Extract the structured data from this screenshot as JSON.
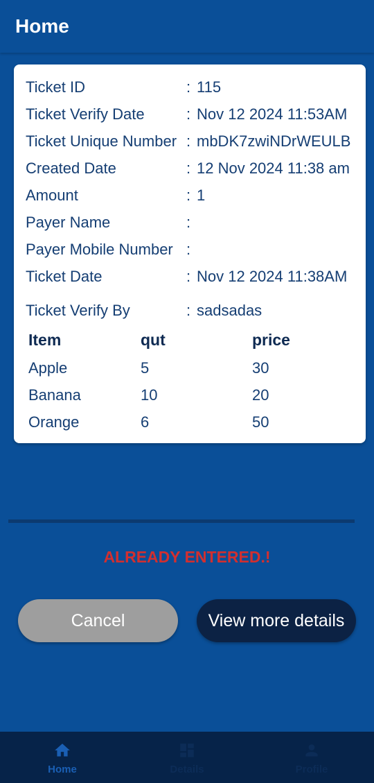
{
  "app_bar": {
    "title": "Home"
  },
  "ticket": {
    "fields": [
      {
        "label": "Ticket ID",
        "value": "115"
      },
      {
        "label": "Ticket Verify Date",
        "value": "Nov 12 2024 11:53AM"
      },
      {
        "label": "Ticket Unique Number",
        "value": "mbDK7zwiNDrWEULB"
      },
      {
        "label": "Created Date",
        "value": "12 Nov 2024 11:38 am"
      },
      {
        "label": "Amount",
        "value": "1"
      },
      {
        "label": "Payer Name",
        "value": ""
      },
      {
        "label": "Payer Mobile Number",
        "value": ""
      },
      {
        "label": "Ticket Date",
        "value": "Nov 12 2024 11:38AM"
      },
      {
        "label": "Ticket Verify By",
        "value": "sadsadas"
      }
    ],
    "separator": ":",
    "items_table": {
      "headers": [
        "Item",
        "qut",
        "price"
      ],
      "rows": [
        [
          "Apple",
          "5",
          "30"
        ],
        [
          "Banana",
          "10",
          "20"
        ],
        [
          "Orange",
          "6",
          "50"
        ]
      ]
    }
  },
  "status": {
    "text": "ALREADY ENTERED.!",
    "color": "#d22f2f"
  },
  "actions": {
    "cancel_label": "Cancel",
    "view_more_label": "View more details"
  },
  "bottom_nav": {
    "items": [
      {
        "label": "Home",
        "icon": "home-icon",
        "active": true
      },
      {
        "label": "Details",
        "icon": "dashboard-icon",
        "active": false
      },
      {
        "label": "Profile",
        "icon": "person-icon",
        "active": false
      }
    ],
    "active_color": "#1a5fb4",
    "inactive_color": "#0c2c57"
  },
  "colors": {
    "primary": "#0a4f98",
    "card": "#ffffff",
    "text": "#153e73",
    "nav_background": "#062349"
  }
}
